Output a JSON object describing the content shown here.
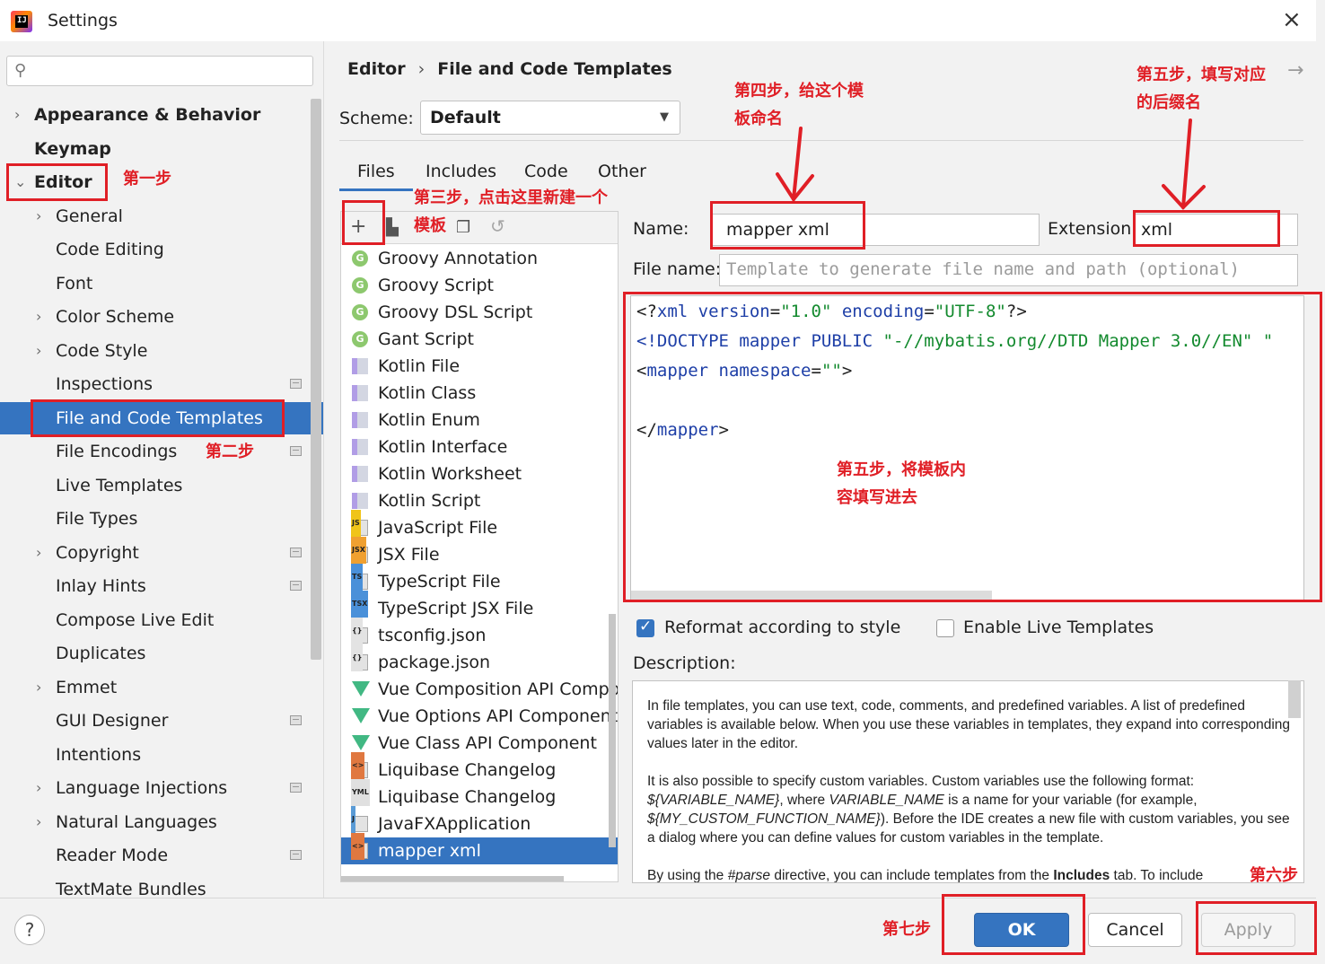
{
  "window": {
    "title": "Settings",
    "close_icon": "×"
  },
  "search": {
    "placeholder": ""
  },
  "sidebar": {
    "items": [
      {
        "label": "Appearance & Behavior",
        "bold": true,
        "arrow": "›"
      },
      {
        "label": "Keymap",
        "bold": true
      },
      {
        "label": "Editor",
        "bold": true,
        "arrow": "⌄"
      },
      {
        "label": "General",
        "arrow": "›"
      },
      {
        "label": "Code Editing"
      },
      {
        "label": "Font"
      },
      {
        "label": "Color Scheme",
        "arrow": "›"
      },
      {
        "label": "Code Style",
        "arrow": "›"
      },
      {
        "label": "Inspections",
        "project": true
      },
      {
        "label": "File and Code Templates",
        "selected": true
      },
      {
        "label": "File Encodings",
        "project": true
      },
      {
        "label": "Live Templates"
      },
      {
        "label": "File Types"
      },
      {
        "label": "Copyright",
        "arrow": "›",
        "project": true
      },
      {
        "label": "Inlay Hints",
        "project": true
      },
      {
        "label": "Compose Live Edit"
      },
      {
        "label": "Duplicates"
      },
      {
        "label": "Emmet",
        "arrow": "›"
      },
      {
        "label": "GUI Designer",
        "project": true
      },
      {
        "label": "Intentions"
      },
      {
        "label": "Language Injections",
        "arrow": "›",
        "project": true
      },
      {
        "label": "Natural Languages",
        "arrow": "›"
      },
      {
        "label": "Reader Mode",
        "project": true
      },
      {
        "label": "TextMate Bundles"
      }
    ]
  },
  "breadcrumb": {
    "part1": "Editor",
    "separator": "›",
    "part2": "File and Code Templates"
  },
  "scheme": {
    "label": "Scheme:",
    "value": "Default"
  },
  "tabs": [
    "Files",
    "Includes",
    "Code",
    "Other"
  ],
  "template_list": {
    "items": [
      {
        "label": "Groovy Annotation",
        "icon": "groovy-icon"
      },
      {
        "label": "Groovy Script",
        "icon": "groovy-icon"
      },
      {
        "label": "Groovy DSL Script",
        "icon": "groovy-icon"
      },
      {
        "label": "Gant Script",
        "icon": "groovy-icon"
      },
      {
        "label": "Kotlin File",
        "icon": "kotlin-icon"
      },
      {
        "label": "Kotlin Class",
        "icon": "kotlin-icon"
      },
      {
        "label": "Kotlin Enum",
        "icon": "kotlin-icon"
      },
      {
        "label": "Kotlin Interface",
        "icon": "kotlin-icon"
      },
      {
        "label": "Kotlin Worksheet",
        "icon": "kotlin-icon"
      },
      {
        "label": "Kotlin Script",
        "icon": "kotlin-icon"
      },
      {
        "label": "JavaScript File",
        "icon": "js-file-icon",
        "badge": "JS"
      },
      {
        "label": "JSX File",
        "icon": "jsx-file-icon",
        "badge": "JSX"
      },
      {
        "label": "TypeScript File",
        "icon": "ts-file-icon",
        "badge": "TS"
      },
      {
        "label": "TypeScript JSX File",
        "icon": "tsx-file-icon",
        "badge": "TSX"
      },
      {
        "label": "tsconfig.json",
        "icon": "json-file-icon",
        "badge": "{}"
      },
      {
        "label": "package.json",
        "icon": "json-file-icon",
        "badge": "{}"
      },
      {
        "label": "Vue Composition API Component",
        "icon": "vue-icon"
      },
      {
        "label": "Vue Options API Component",
        "icon": "vue-icon"
      },
      {
        "label": "Vue Class API Component",
        "icon": "vue-icon"
      },
      {
        "label": "Liquibase Changelog",
        "icon": "xml-file-icon",
        "badge": "<>"
      },
      {
        "label": "Liquibase Changelog",
        "icon": "yml-file-icon",
        "badge": "YML"
      },
      {
        "label": "JavaFXApplication",
        "icon": "java-file-icon",
        "badge": "J"
      },
      {
        "label": "mapper xml",
        "icon": "xml-file-icon",
        "badge": "<>",
        "selected": true
      }
    ]
  },
  "form": {
    "name_label": "Name:",
    "name_value": "mapper xml",
    "extension_label": "Extension:",
    "extension_value": "xml",
    "filename_label": "File name:",
    "filename_placeholder": "Template to generate file name and path (optional)"
  },
  "code_lines": [
    {
      "parts": [
        [
          "c-punc",
          "<?"
        ],
        [
          "c-tag",
          "xml "
        ],
        [
          "c-attr",
          "version"
        ],
        [
          "c-punc",
          "="
        ],
        [
          "c-val",
          "\"1.0\" "
        ],
        [
          "c-attr",
          "encoding"
        ],
        [
          "c-punc",
          "="
        ],
        [
          "c-val",
          "\"UTF-8\""
        ],
        [
          "c-punc",
          "?>"
        ]
      ]
    },
    {
      "parts": [
        [
          "c-tag",
          "<!DOCTYPE mapper PUBLIC "
        ],
        [
          "c-val",
          "\"-//mybatis.org//DTD Mapper 3.0//EN\" \""
        ]
      ]
    },
    {
      "parts": [
        [
          "c-punc",
          "<"
        ],
        [
          "c-tag",
          "mapper "
        ],
        [
          "c-attr",
          "namespace"
        ],
        [
          "c-punc",
          "="
        ],
        [
          "c-val",
          "\"\""
        ],
        [
          "c-punc",
          ">"
        ]
      ]
    },
    {
      "parts": []
    },
    {
      "parts": [
        [
          "c-punc",
          "</"
        ],
        [
          "c-tag",
          "mapper"
        ],
        [
          "c-punc",
          ">"
        ]
      ]
    }
  ],
  "options": {
    "reformat_label": "Reformat according to style",
    "reformat_checked": true,
    "live_templates_label": "Enable Live Templates",
    "live_templates_checked": false
  },
  "description": {
    "label": "Description:",
    "para1": "In file templates, you can use text, code, comments, and predefined variables. A list of predefined variables is available below. When you use these variables in templates, they expand into corresponding values later in the editor.",
    "para2_a": "It is also possible to specify custom variables. Custom variables use the following format: ",
    "para2_var1": "${VARIABLE_NAME}",
    "para2_b": ", where ",
    "para2_var2": "VARIABLE_NAME",
    "para2_c": " is a name for your variable (for example, ",
    "para2_var3": "${MY_CUSTOM_FUNCTION_NAME}",
    "para2_d": "). Before the IDE creates a new file with custom variables, you see a dialog where you can define values for custom variables in the template.",
    "para3_a": "By using the ",
    "para3_var": "#parse",
    "para3_b": " directive, you can include templates from the ",
    "para3_bold": "Includes",
    "para3_c": " tab. To include"
  },
  "buttons": {
    "help": "?",
    "ok": "OK",
    "cancel": "Cancel",
    "apply": "Apply"
  },
  "annotations": {
    "step1": "第一步",
    "step2": "第二步",
    "step3": "第三步，点击这里新建一个",
    "step3b": "模板",
    "step4a": "第四步，给这个模",
    "step4b": "板命名",
    "step5a": "第五步，填写对应",
    "step5b": "的后缀名",
    "step5c": "第五步，将模板内",
    "step5d": "容填写进去",
    "step6": "第六步",
    "step7": "第七步"
  },
  "colors": {
    "accent": "#3574c0",
    "annotation": "#e01f26",
    "panel_bg": "#f2f2f2"
  }
}
